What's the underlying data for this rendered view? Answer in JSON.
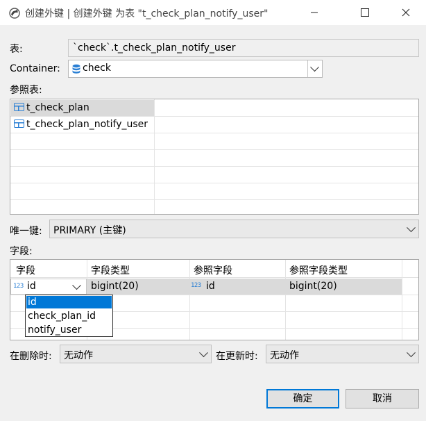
{
  "window": {
    "title": "创建外键 | 创建外键 为表 \"t_check_plan_notify_user\"",
    "controls": [
      "minimize",
      "maximize",
      "close"
    ]
  },
  "table_field": {
    "label": "表:",
    "value": "`check`.t_check_plan_notify_user"
  },
  "container": {
    "label": "Container:",
    "value": "check",
    "icon": "database-icon"
  },
  "ref_tables": {
    "label": "参照表:",
    "items": [
      {
        "name": "t_check_plan",
        "selected": true
      },
      {
        "name": "t_check_plan_notify_user",
        "selected": false
      }
    ]
  },
  "unique_key": {
    "label": "唯一键:",
    "value": "PRIMARY (主键)"
  },
  "fields": {
    "label": "字段:",
    "columns": [
      "字段",
      "字段类型",
      "参照字段",
      "参照字段类型"
    ],
    "rows": [
      {
        "field": "id",
        "type": "bigint(20)",
        "ref_field": "id",
        "ref_type": "bigint(20)"
      }
    ],
    "dropdown_options": [
      "id",
      "check_plan_id",
      "notify_user"
    ],
    "dropdown_selected": "id",
    "num_icon_text": "123"
  },
  "on_delete": {
    "label": "在删除时:",
    "value": "无动作"
  },
  "on_update": {
    "label": "在更新时:",
    "value": "无动作"
  },
  "buttons": {
    "ok": "确定",
    "cancel": "取消"
  },
  "colors": {
    "accent": "#0078d7",
    "selection": "#0078d7",
    "icon_blue": "#2a7fd4"
  }
}
